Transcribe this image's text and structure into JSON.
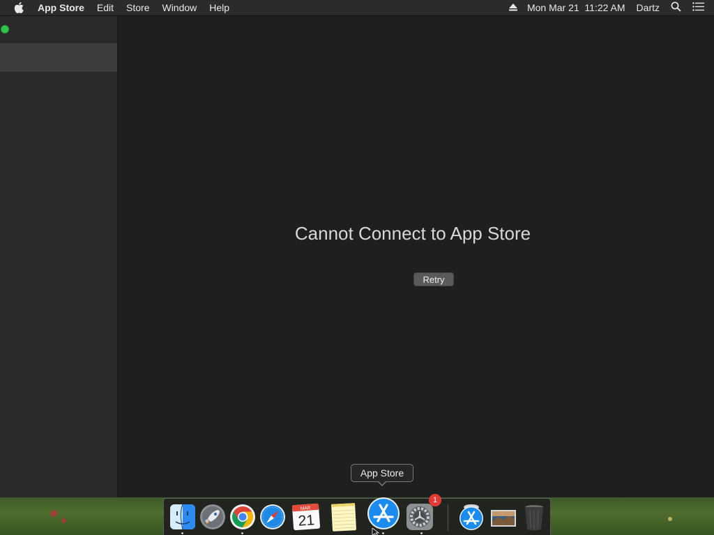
{
  "menubar": {
    "apple_icon": "apple-logo",
    "app_name": "App Store",
    "items": [
      "Edit",
      "Store",
      "Window",
      "Help"
    ],
    "datetime": "Mon Mar 21  11:22 AM",
    "user": "Dartz",
    "status_icons": [
      "eject-icon",
      "spotlight-search-icon",
      "notification-center-icon"
    ]
  },
  "window": {
    "error_title": "Cannot Connect to App Store",
    "retry_label": "Retry"
  },
  "tooltip": {
    "label": "App Store"
  },
  "dock": {
    "items": [
      {
        "name": "Finder",
        "icon": "finder-icon",
        "running": true
      },
      {
        "name": "Launchpad",
        "icon": "launchpad-icon",
        "running": false
      },
      {
        "name": "Google Chrome",
        "icon": "chrome-icon",
        "running": true
      },
      {
        "name": "Safari",
        "icon": "safari-icon",
        "running": false
      },
      {
        "name": "Calendar",
        "icon": "calendar-icon",
        "running": false,
        "month": "MAR",
        "day": "21"
      },
      {
        "name": "Notes",
        "icon": "notes-icon",
        "running": false
      },
      {
        "name": "App Store",
        "icon": "app-store-icon",
        "running": true
      },
      {
        "name": "System Preferences",
        "icon": "system-preferences-icon",
        "running": true,
        "badge": "1"
      },
      {
        "name": "App Store Downloads",
        "icon": "app-store-downloads-icon",
        "running": false
      },
      {
        "name": "Desktop Picture",
        "icon": "image-stack-icon",
        "running": false
      },
      {
        "name": "Trash",
        "icon": "trash-icon",
        "running": false
      }
    ]
  },
  "colors": {
    "menubar_bg": "#2b2b2b",
    "window_bg": "#1f1f1f",
    "sidebar_bg": "#2a2a2a",
    "sidebar_selected": "#3d3d3d",
    "green_button": "#2fc54a",
    "badge_red": "#e53935"
  }
}
